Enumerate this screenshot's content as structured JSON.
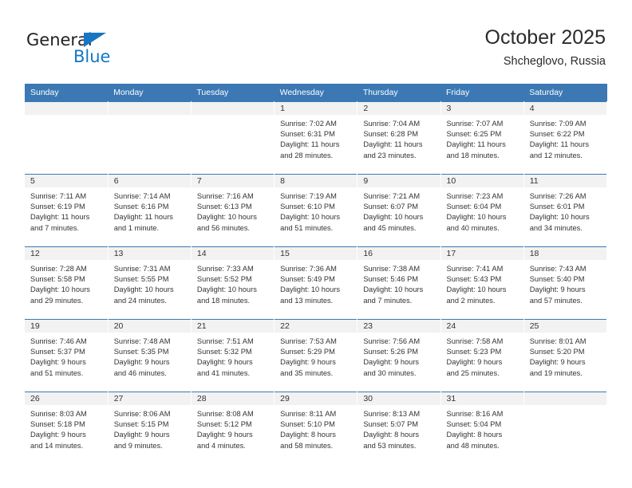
{
  "brand": {
    "name_top": "General",
    "name_bottom": "Blue",
    "triangle_color": "#1577c4",
    "text_color": "#231f20"
  },
  "header": {
    "title": "October 2025",
    "subtitle": "Shcheglovo, Russia",
    "header_bg_color": "#3b78b4",
    "header_text_color": "#ffffff"
  },
  "weekdays": [
    "Sunday",
    "Monday",
    "Tuesday",
    "Wednesday",
    "Thursday",
    "Friday",
    "Saturday"
  ],
  "labels": {
    "sunrise_prefix": "Sunrise:",
    "sunset_prefix": "Sunset:",
    "daylight_prefix": "Daylight:"
  },
  "weeks": [
    [
      {
        "day": "",
        "sunrise": "",
        "sunset": "",
        "daylight_line1": "",
        "daylight_line2": "",
        "empty": true
      },
      {
        "day": "",
        "sunrise": "",
        "sunset": "",
        "daylight_line1": "",
        "daylight_line2": "",
        "empty": true
      },
      {
        "day": "",
        "sunrise": "",
        "sunset": "",
        "daylight_line1": "",
        "daylight_line2": "",
        "empty": true
      },
      {
        "day": "1",
        "sunrise": "Sunrise: 7:02 AM",
        "sunset": "Sunset: 6:31 PM",
        "daylight_line1": "Daylight: 11 hours",
        "daylight_line2": "and 28 minutes.",
        "empty": false
      },
      {
        "day": "2",
        "sunrise": "Sunrise: 7:04 AM",
        "sunset": "Sunset: 6:28 PM",
        "daylight_line1": "Daylight: 11 hours",
        "daylight_line2": "and 23 minutes.",
        "empty": false
      },
      {
        "day": "3",
        "sunrise": "Sunrise: 7:07 AM",
        "sunset": "Sunset: 6:25 PM",
        "daylight_line1": "Daylight: 11 hours",
        "daylight_line2": "and 18 minutes.",
        "empty": false
      },
      {
        "day": "4",
        "sunrise": "Sunrise: 7:09 AM",
        "sunset": "Sunset: 6:22 PM",
        "daylight_line1": "Daylight: 11 hours",
        "daylight_line2": "and 12 minutes.",
        "empty": false
      }
    ],
    [
      {
        "day": "5",
        "sunrise": "Sunrise: 7:11 AM",
        "sunset": "Sunset: 6:19 PM",
        "daylight_line1": "Daylight: 11 hours",
        "daylight_line2": "and 7 minutes.",
        "empty": false
      },
      {
        "day": "6",
        "sunrise": "Sunrise: 7:14 AM",
        "sunset": "Sunset: 6:16 PM",
        "daylight_line1": "Daylight: 11 hours",
        "daylight_line2": "and 1 minute.",
        "empty": false
      },
      {
        "day": "7",
        "sunrise": "Sunrise: 7:16 AM",
        "sunset": "Sunset: 6:13 PM",
        "daylight_line1": "Daylight: 10 hours",
        "daylight_line2": "and 56 minutes.",
        "empty": false
      },
      {
        "day": "8",
        "sunrise": "Sunrise: 7:19 AM",
        "sunset": "Sunset: 6:10 PM",
        "daylight_line1": "Daylight: 10 hours",
        "daylight_line2": "and 51 minutes.",
        "empty": false
      },
      {
        "day": "9",
        "sunrise": "Sunrise: 7:21 AM",
        "sunset": "Sunset: 6:07 PM",
        "daylight_line1": "Daylight: 10 hours",
        "daylight_line2": "and 45 minutes.",
        "empty": false
      },
      {
        "day": "10",
        "sunrise": "Sunrise: 7:23 AM",
        "sunset": "Sunset: 6:04 PM",
        "daylight_line1": "Daylight: 10 hours",
        "daylight_line2": "and 40 minutes.",
        "empty": false
      },
      {
        "day": "11",
        "sunrise": "Sunrise: 7:26 AM",
        "sunset": "Sunset: 6:01 PM",
        "daylight_line1": "Daylight: 10 hours",
        "daylight_line2": "and 34 minutes.",
        "empty": false
      }
    ],
    [
      {
        "day": "12",
        "sunrise": "Sunrise: 7:28 AM",
        "sunset": "Sunset: 5:58 PM",
        "daylight_line1": "Daylight: 10 hours",
        "daylight_line2": "and 29 minutes.",
        "empty": false
      },
      {
        "day": "13",
        "sunrise": "Sunrise: 7:31 AM",
        "sunset": "Sunset: 5:55 PM",
        "daylight_line1": "Daylight: 10 hours",
        "daylight_line2": "and 24 minutes.",
        "empty": false
      },
      {
        "day": "14",
        "sunrise": "Sunrise: 7:33 AM",
        "sunset": "Sunset: 5:52 PM",
        "daylight_line1": "Daylight: 10 hours",
        "daylight_line2": "and 18 minutes.",
        "empty": false
      },
      {
        "day": "15",
        "sunrise": "Sunrise: 7:36 AM",
        "sunset": "Sunset: 5:49 PM",
        "daylight_line1": "Daylight: 10 hours",
        "daylight_line2": "and 13 minutes.",
        "empty": false
      },
      {
        "day": "16",
        "sunrise": "Sunrise: 7:38 AM",
        "sunset": "Sunset: 5:46 PM",
        "daylight_line1": "Daylight: 10 hours",
        "daylight_line2": "and 7 minutes.",
        "empty": false
      },
      {
        "day": "17",
        "sunrise": "Sunrise: 7:41 AM",
        "sunset": "Sunset: 5:43 PM",
        "daylight_line1": "Daylight: 10 hours",
        "daylight_line2": "and 2 minutes.",
        "empty": false
      },
      {
        "day": "18",
        "sunrise": "Sunrise: 7:43 AM",
        "sunset": "Sunset: 5:40 PM",
        "daylight_line1": "Daylight: 9 hours",
        "daylight_line2": "and 57 minutes.",
        "empty": false
      }
    ],
    [
      {
        "day": "19",
        "sunrise": "Sunrise: 7:46 AM",
        "sunset": "Sunset: 5:37 PM",
        "daylight_line1": "Daylight: 9 hours",
        "daylight_line2": "and 51 minutes.",
        "empty": false
      },
      {
        "day": "20",
        "sunrise": "Sunrise: 7:48 AM",
        "sunset": "Sunset: 5:35 PM",
        "daylight_line1": "Daylight: 9 hours",
        "daylight_line2": "and 46 minutes.",
        "empty": false
      },
      {
        "day": "21",
        "sunrise": "Sunrise: 7:51 AM",
        "sunset": "Sunset: 5:32 PM",
        "daylight_line1": "Daylight: 9 hours",
        "daylight_line2": "and 41 minutes.",
        "empty": false
      },
      {
        "day": "22",
        "sunrise": "Sunrise: 7:53 AM",
        "sunset": "Sunset: 5:29 PM",
        "daylight_line1": "Daylight: 9 hours",
        "daylight_line2": "and 35 minutes.",
        "empty": false
      },
      {
        "day": "23",
        "sunrise": "Sunrise: 7:56 AM",
        "sunset": "Sunset: 5:26 PM",
        "daylight_line1": "Daylight: 9 hours",
        "daylight_line2": "and 30 minutes.",
        "empty": false
      },
      {
        "day": "24",
        "sunrise": "Sunrise: 7:58 AM",
        "sunset": "Sunset: 5:23 PM",
        "daylight_line1": "Daylight: 9 hours",
        "daylight_line2": "and 25 minutes.",
        "empty": false
      },
      {
        "day": "25",
        "sunrise": "Sunrise: 8:01 AM",
        "sunset": "Sunset: 5:20 PM",
        "daylight_line1": "Daylight: 9 hours",
        "daylight_line2": "and 19 minutes.",
        "empty": false
      }
    ],
    [
      {
        "day": "26",
        "sunrise": "Sunrise: 8:03 AM",
        "sunset": "Sunset: 5:18 PM",
        "daylight_line1": "Daylight: 9 hours",
        "daylight_line2": "and 14 minutes.",
        "empty": false
      },
      {
        "day": "27",
        "sunrise": "Sunrise: 8:06 AM",
        "sunset": "Sunset: 5:15 PM",
        "daylight_line1": "Daylight: 9 hours",
        "daylight_line2": "and 9 minutes.",
        "empty": false
      },
      {
        "day": "28",
        "sunrise": "Sunrise: 8:08 AM",
        "sunset": "Sunset: 5:12 PM",
        "daylight_line1": "Daylight: 9 hours",
        "daylight_line2": "and 4 minutes.",
        "empty": false
      },
      {
        "day": "29",
        "sunrise": "Sunrise: 8:11 AM",
        "sunset": "Sunset: 5:10 PM",
        "daylight_line1": "Daylight: 8 hours",
        "daylight_line2": "and 58 minutes.",
        "empty": false
      },
      {
        "day": "30",
        "sunrise": "Sunrise: 8:13 AM",
        "sunset": "Sunset: 5:07 PM",
        "daylight_line1": "Daylight: 8 hours",
        "daylight_line2": "and 53 minutes.",
        "empty": false
      },
      {
        "day": "31",
        "sunrise": "Sunrise: 8:16 AM",
        "sunset": "Sunset: 5:04 PM",
        "daylight_line1": "Daylight: 8 hours",
        "daylight_line2": "and 48 minutes.",
        "empty": false
      },
      {
        "day": "",
        "sunrise": "",
        "sunset": "",
        "daylight_line1": "",
        "daylight_line2": "",
        "empty": true
      }
    ]
  ]
}
